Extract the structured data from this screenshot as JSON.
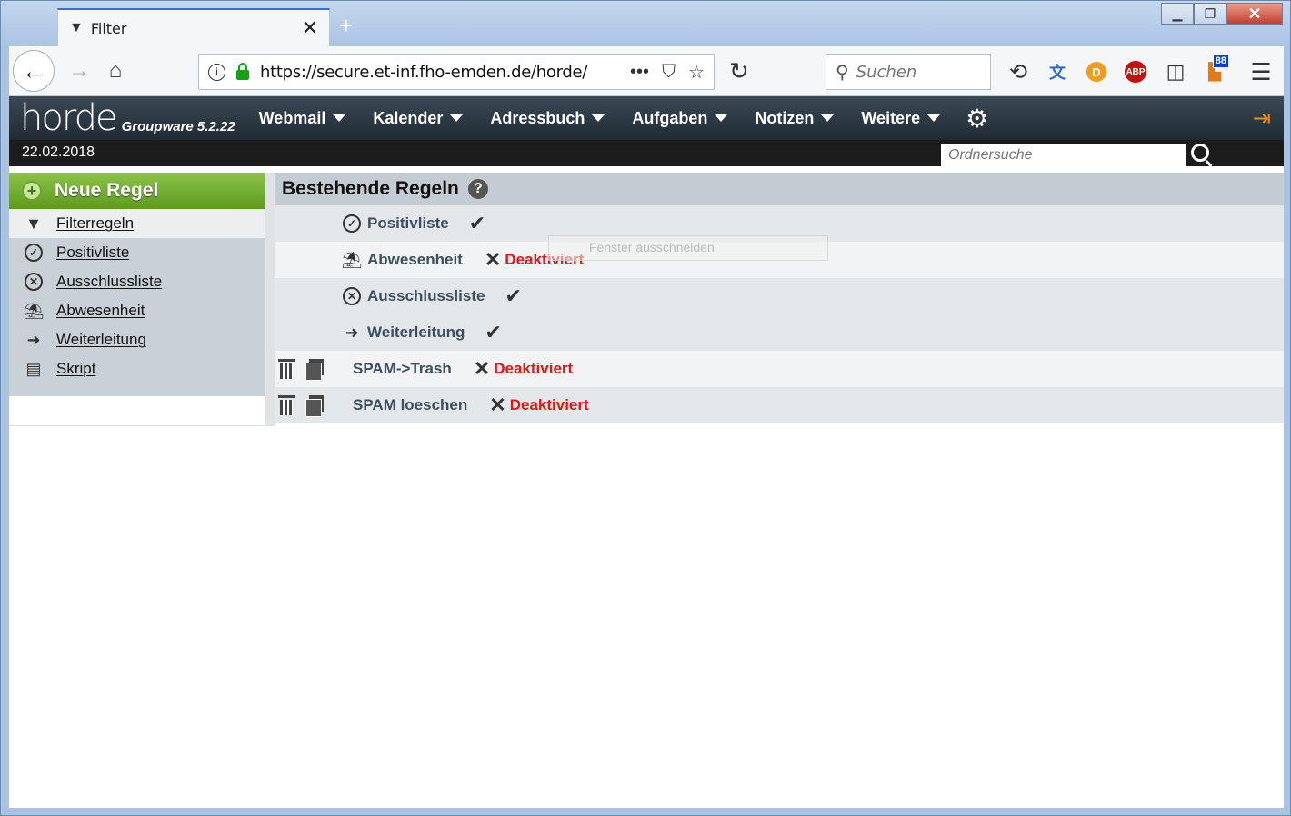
{
  "browser": {
    "tab_title": "Filter",
    "tab_close": "✕",
    "new_tab": "+",
    "url": "https://secure.et-inf.fho-emden.de/horde/",
    "search_placeholder": "Suchen",
    "badge_count": "88",
    "abp_label": "ABP",
    "ddg_label": "D"
  },
  "horde": {
    "logo": "horde",
    "version": "Groupware 5.2.22",
    "menu": [
      {
        "label": "Webmail"
      },
      {
        "label": "Kalender"
      },
      {
        "label": "Adressbuch"
      },
      {
        "label": "Aufgaben"
      },
      {
        "label": "Notizen"
      },
      {
        "label": "Weitere"
      }
    ],
    "date": "22.02.2018",
    "folder_search_placeholder": "Ordnersuche"
  },
  "sidebar": {
    "new_rule": "Neue Regel",
    "items": [
      {
        "label": "Filterregeln",
        "icon": "filter-icon"
      },
      {
        "label": "Positivliste",
        "icon": "check-circle-icon"
      },
      {
        "label": "Ausschlussliste",
        "icon": "x-circle-icon"
      },
      {
        "label": "Abwesenheit",
        "icon": "vacation-icon"
      },
      {
        "label": "Weiterleitung",
        "icon": "arrow-right-icon"
      },
      {
        "label": "Skript",
        "icon": "script-icon"
      }
    ]
  },
  "main": {
    "title": "Bestehende Regeln",
    "help": "?",
    "rules": [
      {
        "name": "Positivliste",
        "status": "enabled"
      },
      {
        "name": "Abwesenheit",
        "status": "Deaktiviert"
      },
      {
        "name": "Ausschlussliste",
        "status": "enabled"
      },
      {
        "name": "Weiterleitung",
        "status": "enabled"
      },
      {
        "name": "SPAM->Trash",
        "status": "Deaktiviert"
      },
      {
        "name": "SPAM loeschen",
        "status": "Deaktiviert"
      }
    ],
    "tooltip": "Fenster ausschneiden"
  },
  "colors": {
    "accent_green": "#7ab33a",
    "deactivated_red": "#e01818",
    "header_dark": "#2c3842"
  }
}
